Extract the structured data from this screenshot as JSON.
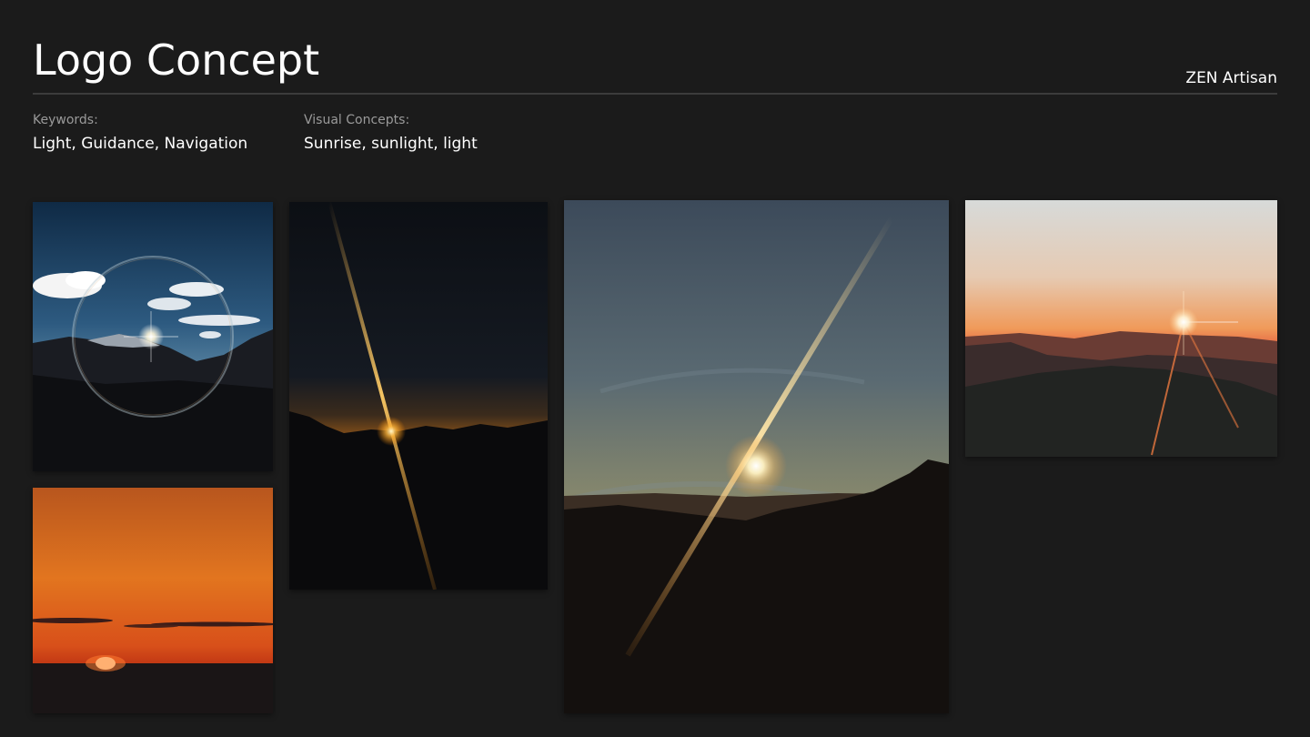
{
  "header": {
    "title": "Logo Concept",
    "brand": "ZEN Artisan"
  },
  "meta": {
    "keywords_label": "Keywords:",
    "keywords_value": "Light, Guidance, Navigation",
    "concepts_label": "Visual Concepts:",
    "concepts_value": "Sunrise, sunlight, light"
  },
  "colors": {
    "background": "#1b1b1b",
    "rule": "#3c3c3c",
    "label": "#9a9a9a",
    "text": "#ffffff"
  }
}
